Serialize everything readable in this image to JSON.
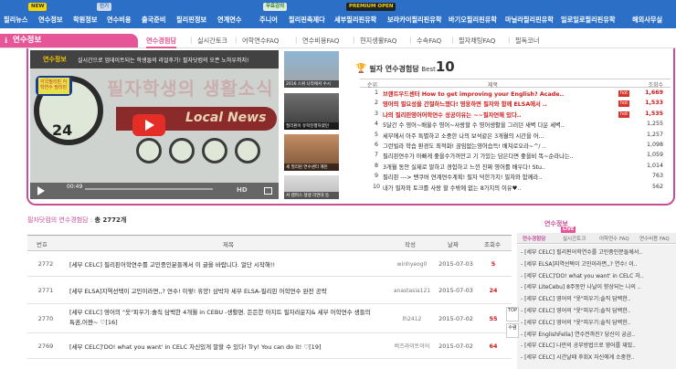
{
  "nav": {
    "badges": {
      "new": "NEW",
      "hot": "인기",
      "free": "무료강의",
      "premium": "PREMIUM OPEN"
    },
    "items": [
      "필리뉴스",
      "연수정보",
      "학원정보",
      "연수비용",
      "출국준비",
      "필리핀정보",
      "연계연수",
      "주니어",
      "필리핀축제다",
      "세부필리핀유학",
      "보라카이필리핀유학",
      "바기오필리핀유학",
      "마닐라필리핀유학",
      "일로일로필리핀유학",
      "해외사무실"
    ]
  },
  "section": {
    "title": "연수정보",
    "tabs": [
      "연수경험담",
      "실시간토크",
      "어학연수FAQ",
      "연수비용FAQ",
      "현지생활FAQ",
      "수속FAQ",
      "필자채팅FAQ",
      "필독코너"
    ]
  },
  "video": {
    "tag": "연수정보",
    "caption": "실시간으로 업데이트되는 학생들의 라얼후기! 필자닷컴의 오픈 노하우까지!",
    "big_title": "필자학생의 생활소식",
    "banner": "Local News",
    "clock_number": "24",
    "phone_text": "각국필리핀 어학연수 필리핀",
    "time": "00:49",
    "hd": "HD"
  },
  "thumbs": [
    "2016 스위 나라에서 수시",
    "필리핀이 유학진행하였던",
    "세 필리핀 연수센터 계된",
    "서 캠퍼스 생생 리연대 등"
  ],
  "ranking": {
    "title": "필자 연수경험담",
    "best": "Best",
    "ten": "10",
    "columns": {
      "rank": "순위",
      "title": "제목",
      "views": "조회수"
    },
    "rows": [
      {
        "n": "1",
        "t": "브랜트우드센터 How to get improving your English? Acade..",
        "hot": "hot",
        "v": "1,669",
        "red": true
      },
      {
        "n": "2",
        "t": "영어의 필요성을 간절하느꼈다! 영웅하면 필자와 함께 ELSA에서 ..",
        "hot": "hot",
        "v": "1,533",
        "red": true
      },
      {
        "n": "3",
        "t": "나의 필리핀영어어학연수 성공이유는 ~~필자연해 있다..",
        "hot": "hot",
        "v": "1,535",
        "red": true
      },
      {
        "n": "4",
        "t": "5달간 수 영어~배울수 영어~사랑할 수 영어생활을 그러던 새벽 다운 세벽..",
        "hot": "",
        "v": "1,255",
        "red": false
      },
      {
        "n": "5",
        "t": "세부에서 아주 특별하고 소중한 나의 보석같은 3개월의 시간을 어...",
        "hot": "",
        "v": "1,257",
        "red": false
      },
      {
        "n": "6",
        "t": "그런빌라 학습 환경도 최적화! 끊임없는영어습득! 배쳐로오라~^/ ..",
        "hot": "",
        "v": "1,098",
        "red": false
      },
      {
        "n": "7",
        "t": "필리핀연수가 아빠게 좋을수가까만고 기 가있는 담은다면 좋을비 똑~순라나는..",
        "hot": "",
        "v": "1,059",
        "red": false
      },
      {
        "n": "8",
        "t": "3개월 동안 실제로 말하고 경험하고 느낀 진짜 영어를 배우다! Stu..",
        "hot": "",
        "v": "1,014",
        "red": false
      },
      {
        "n": "9",
        "t": "필리핀 ---> 밴쿠버 연계연수계획! 필자 덕한가지! 필자와 함께라..",
        "hot": "",
        "v": "763",
        "red": false
      },
      {
        "n": "10",
        "t": "내가 필자와 토크를 사랑 할 수밖에 없는 8가지의 이유♥..",
        "hot": "",
        "v": "562",
        "red": false
      }
    ]
  },
  "board": {
    "title_prefix": "필자닷컴의 연수경험담 :",
    "title_count": "총 2772개",
    "columns": {
      "num": "번호",
      "title": "제목",
      "writer": "작성",
      "date": "날짜",
      "views": "조회수"
    },
    "rows": [
      {
        "num": "2772",
        "title": "[세부 CELC] 필리핀어학연수를 고민중인분들께서 이 글을 바랍니다. 얼단 시작해!!",
        "writer": "winhyeog0",
        "date": "2015-07-03",
        "views": "5"
      },
      {
        "num": "2771",
        "title": "[세부 ELSA]지역선택이 고민이라면,,? 연수! 이렇! 휴양! 삼박자 세부 ELSA-필리핀 어학연수 완전 공략",
        "writer": "anastasia121",
        "date": "2015-07-03",
        "views": "24"
      },
      {
        "num": "2770",
        "title": "[세부 CELC] 영어의 \"옷\"피우기:솔직 담백한 4개월 in CEBU -생활편. 든든한 아지트 필자라운지& 세부 어학연수 생들의 특권,어쨘~ ♡[16]",
        "writer": "lh2412",
        "date": "2015-07-02",
        "views": "55"
      },
      {
        "num": "2769",
        "title": "[세부 CELC]'DO! what you want' in CELC 자신있게 말할 수 있다! Try! You can do it! ♡[19]",
        "writer": "버즈라이트이어",
        "date": "2015-07-02",
        "views": "64"
      }
    ]
  },
  "right": {
    "title": "연수정보",
    "live": "LIVE",
    "tabs": [
      "연수경험담",
      "실시간토크",
      "어학연수 FAQ",
      "연수비용 FAQ"
    ],
    "items": [
      "- [세부 CELC] 필리핀어학연수를 고민중인분들께서..",
      "- [세부 ELSA]지역선택이 고민이라면,,? 연수! 이..",
      "- [세부 CELC]'DO! what you want' in CELC 자..",
      "- [세부 LiteCebu] 8주동안 나날이 향상되는 나의 ..",
      "- [세부 CELC] 영어의 \"옷\"피우기:솔직 담백한..",
      "- [세부 CELC] 영어의 \"옷\"피우기:솔직 담백한..",
      "- [세부 CELC] 영어의 \"옷\"피우기:솔직 담백한..",
      "- [세부 EnglishFella] 연수전까진? 당신이 궁금..",
      "- [세부 CELC] 나만의 공부방법으로 영어를 재밌..",
      "- [세부 CELC] 시간날때 후회X 자신에게 소중한.."
    ],
    "side_top": "TOP",
    "side_bottom": "수렴"
  }
}
